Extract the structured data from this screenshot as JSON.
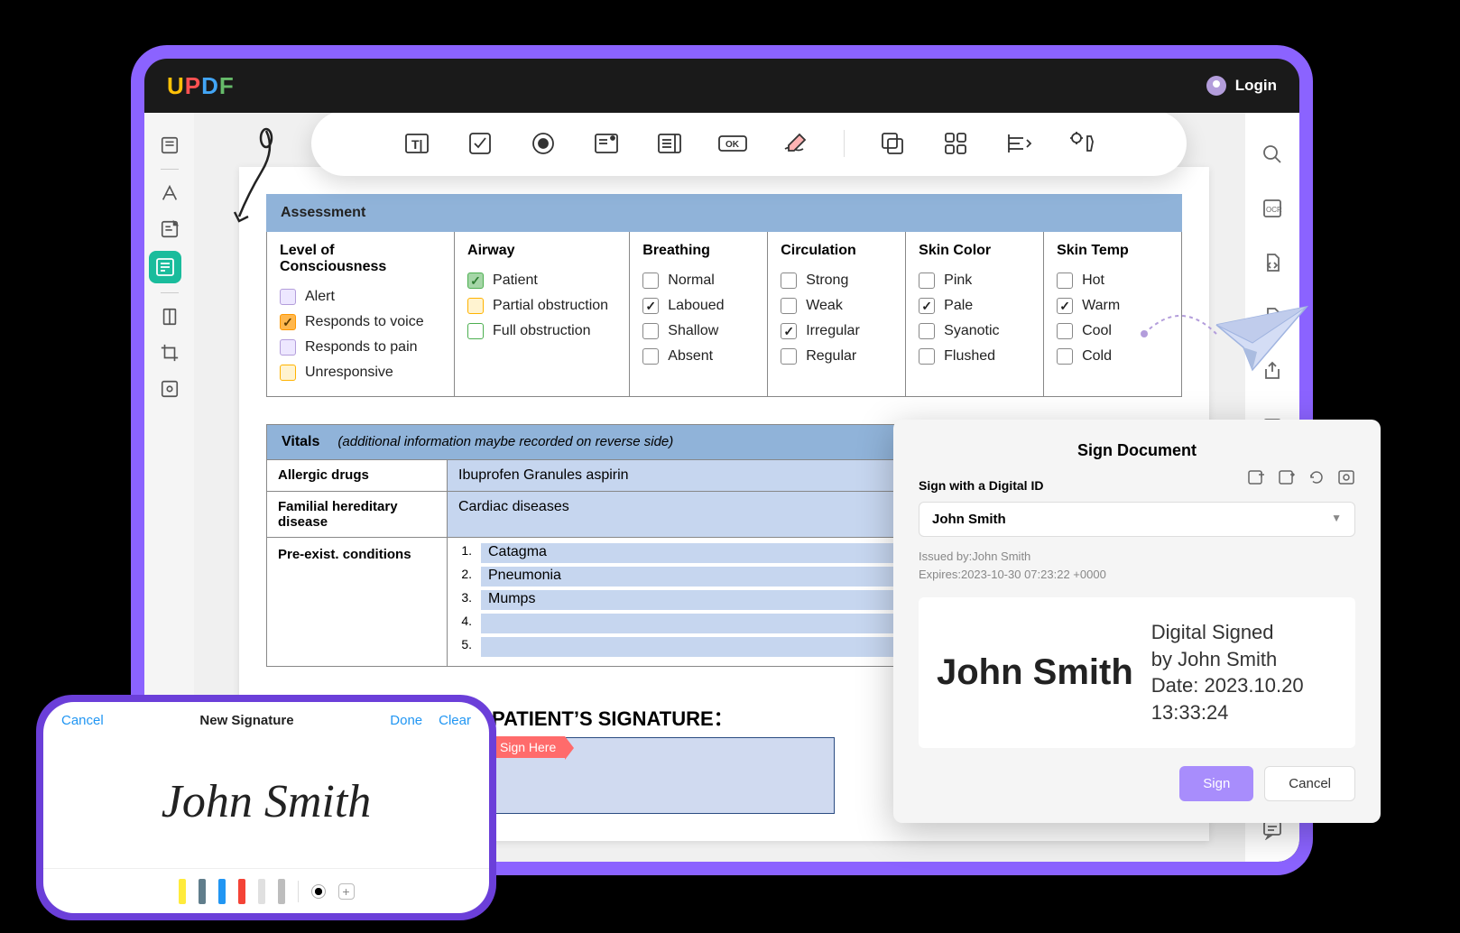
{
  "app": {
    "name": "UPDF",
    "login_label": "Login"
  },
  "assessment": {
    "header": "Assessment",
    "columns": {
      "loc": {
        "title": "Level of Consciousness",
        "items": [
          {
            "label": "Alert",
            "style": "cb-purple",
            "checked": false
          },
          {
            "label": "Responds to voice",
            "style": "cb-orange",
            "checked": true
          },
          {
            "label": "Responds to pain",
            "style": "cb-purple",
            "checked": false
          },
          {
            "label": "Unresponsive",
            "style": "cb-yellow",
            "checked": false
          }
        ]
      },
      "airway": {
        "title": "Airway",
        "items": [
          {
            "label": "Patient",
            "style": "cb-green",
            "checked": true
          },
          {
            "label": "Partial obstruction",
            "style": "cb-yellow",
            "checked": false
          },
          {
            "label": "Full obstruction",
            "style": "cb-greenline",
            "checked": false
          }
        ]
      },
      "breathing": {
        "title": "Breathing",
        "items": [
          {
            "label": "Normal",
            "style": "",
            "checked": false
          },
          {
            "label": "Laboued",
            "style": "",
            "checked": true
          },
          {
            "label": "Shallow",
            "style": "",
            "checked": false
          },
          {
            "label": "Absent",
            "style": "",
            "checked": false
          }
        ]
      },
      "circulation": {
        "title": "Circulation",
        "items": [
          {
            "label": "Strong",
            "style": "",
            "checked": false
          },
          {
            "label": "Weak",
            "style": "",
            "checked": false
          },
          {
            "label": "Irregular",
            "style": "",
            "checked": true
          },
          {
            "label": "Regular",
            "style": "",
            "checked": false
          }
        ]
      },
      "skincolor": {
        "title": "Skin Color",
        "items": [
          {
            "label": "Pink",
            "style": "",
            "checked": false
          },
          {
            "label": "Pale",
            "style": "",
            "checked": true
          },
          {
            "label": "Syanotic",
            "style": "",
            "checked": false
          },
          {
            "label": "Flushed",
            "style": "",
            "checked": false
          }
        ]
      },
      "skintemp": {
        "title": "Skin Temp",
        "items": [
          {
            "label": "Hot",
            "style": "",
            "checked": false
          },
          {
            "label": "Warm",
            "style": "",
            "checked": true
          },
          {
            "label": "Cool",
            "style": "",
            "checked": false
          },
          {
            "label": "Cold",
            "style": "",
            "checked": false
          }
        ]
      }
    }
  },
  "vitals": {
    "title": "Vitals",
    "subtitle": "(additional information maybe recorded on reverse side)",
    "rows": {
      "allergic": {
        "label": "Allergic drugs",
        "value": "Ibuprofen Granules  aspirin"
      },
      "familial": {
        "label": "Familial hereditary disease",
        "value": "Cardiac diseases"
      },
      "preexist": {
        "label": "Pre-exist. conditions",
        "lines": [
          {
            "num": "1.",
            "value": "Catagma"
          },
          {
            "num": "2.",
            "value": "Pneumonia"
          },
          {
            "num": "3.",
            "value": "Mumps"
          },
          {
            "num": "4.",
            "value": ""
          },
          {
            "num": "5.",
            "value": ""
          }
        ]
      }
    }
  },
  "signature_section": {
    "heading": "PATIENT’S SIGNATURE：",
    "tag": "Sign Here"
  },
  "sign_dialog": {
    "title": "Sign Document",
    "subtitle": "Sign with a Digital ID",
    "selected_id": "John Smith",
    "issued_by": "Issued by:John Smith",
    "expires": "Expires:2023-10-30 07:23:22 +0000",
    "preview_name": "John Smith",
    "preview_details_l1": "Digital Signed",
    "preview_details_l2": "by John Smith",
    "preview_details_l3": "Date: 2023.10.20",
    "preview_details_l4": "13:33:24",
    "sign_btn": "Sign",
    "cancel_btn": "Cancel"
  },
  "phone": {
    "cancel": "Cancel",
    "title": "New Signature",
    "done": "Done",
    "clear": "Clear",
    "signature_text": "John Smith"
  }
}
